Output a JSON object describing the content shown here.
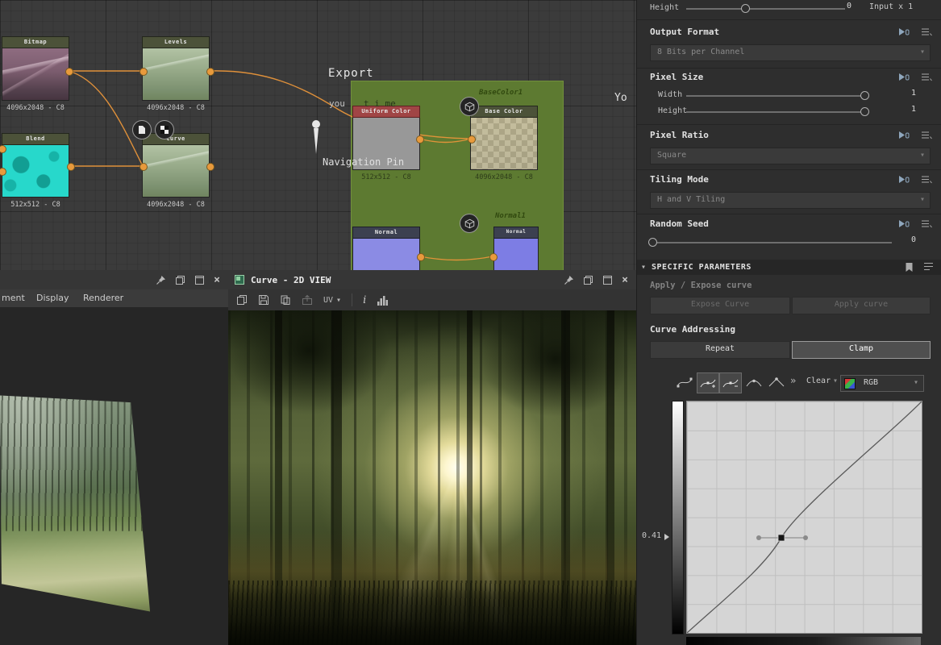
{
  "colors": {
    "accent_orange": "#e8953a",
    "frame_green": "#5d7a31",
    "panel_bg": "#2e2e2e",
    "selected_button_border": "#9a9a9a"
  },
  "icons": {
    "chevron_down": "▾",
    "close": "×",
    "double_chevron": "»",
    "marker_triangle": "▷"
  },
  "graph": {
    "export_label": "Export",
    "comment_left": "you",
    "comment_right": "t i me",
    "comment_far_right": "Yo",
    "navigation_pin_label": "Navigation Pin",
    "output_labels": {
      "base_color": "BaseColor1",
      "normal": "Normal1"
    },
    "nodes": {
      "bitmap": {
        "title": "Bitmap",
        "subtitle": "4096x2048 - C8"
      },
      "levels": {
        "title": "Levels",
        "subtitle": "4096x2048 - C8"
      },
      "blend": {
        "title": "Blend",
        "subtitle": "512x512 - C8"
      },
      "curve": {
        "title": "Curve",
        "subtitle": "4096x2048 - C8"
      },
      "uniform_color": {
        "title": "Uniform Color",
        "subtitle": "512x512 - C8"
      },
      "base_color": {
        "title": "Base Color",
        "subtitle": "4096x2048 - C8"
      },
      "normal_a": {
        "title": "Normal"
      },
      "normal_b": {
        "title": "Normal"
      }
    }
  },
  "panel": {
    "height_row": {
      "label": "Height",
      "value": "0",
      "meta": "Input x 1"
    },
    "output_format": {
      "label": "Output Format",
      "value": "8 Bits per Channel"
    },
    "pixel_size": {
      "label": "Pixel Size",
      "width_label": "Width",
      "width_value": "1",
      "height_label": "Height",
      "height_value": "1"
    },
    "pixel_ratio": {
      "label": "Pixel Ratio",
      "value": "Square"
    },
    "tiling_mode": {
      "label": "Tiling Mode",
      "value": "H and V Tiling"
    },
    "random_seed": {
      "label": "Random Seed",
      "value": "0"
    },
    "specific_parameters_header": "SPECIFIC PARAMETERS",
    "apply_expose": {
      "label": "Apply / Expose curve",
      "expose": "Expose Curve",
      "apply": "Apply curve"
    },
    "curve_addressing": {
      "label": "Curve Addressing",
      "repeat": "Repeat",
      "clamp": "Clamp"
    },
    "curve_tools": {
      "clear": "Clear",
      "channel": "RGB"
    },
    "curve_editor": {
      "marker_value": "0.41"
    }
  },
  "viewport3d": {
    "menu": [
      {
        "label": "ment"
      },
      {
        "label": "Display"
      },
      {
        "label": "Renderer"
      }
    ]
  },
  "view2d": {
    "title": "Curve - 2D VIEW",
    "uv": "UV"
  }
}
